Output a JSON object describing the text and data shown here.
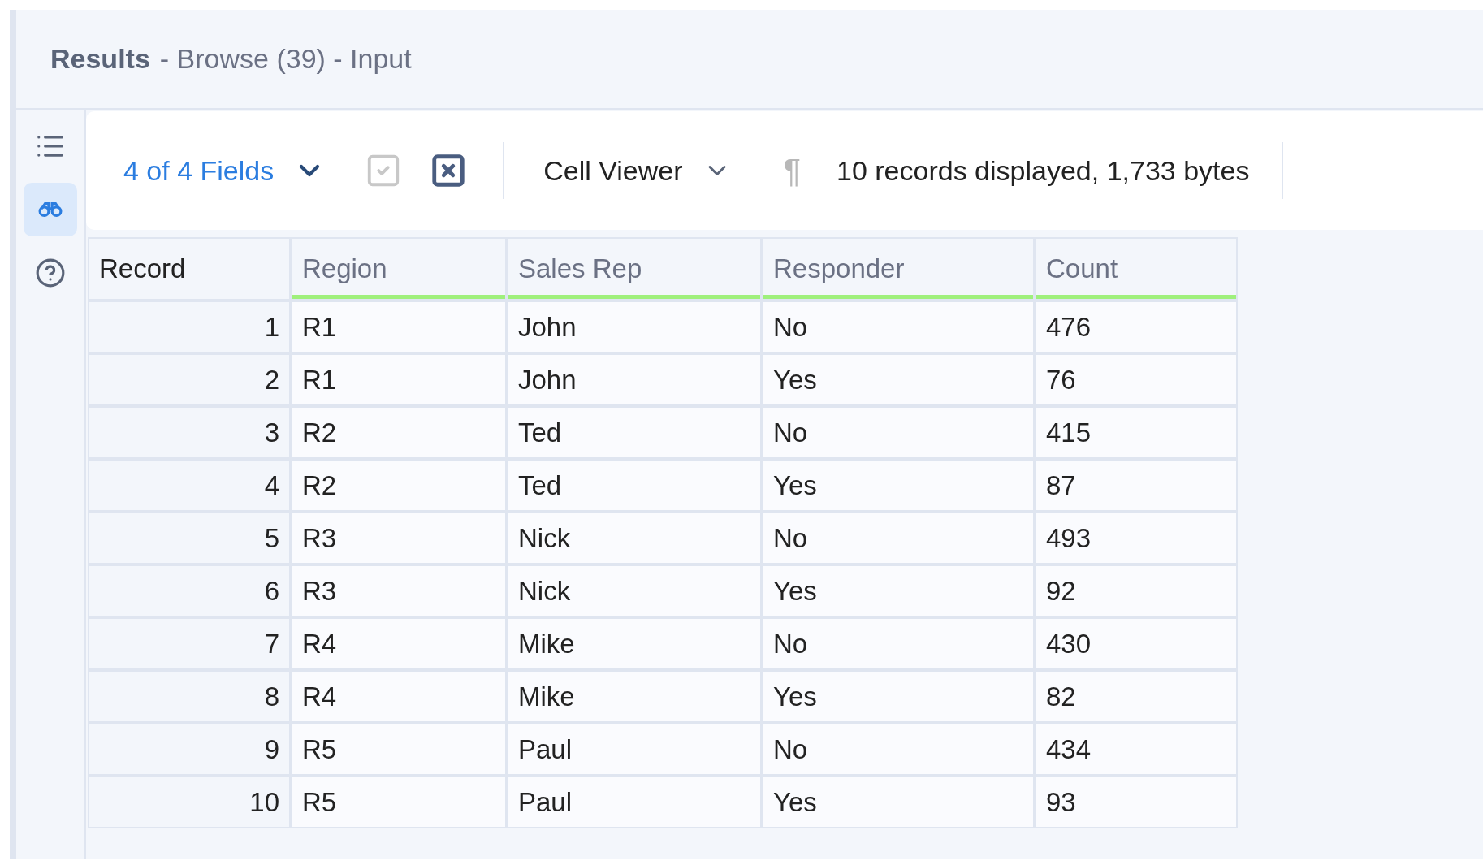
{
  "header": {
    "title": "Results",
    "subtitle": "- Browse (39) - Input"
  },
  "sidebar": {
    "items": [
      {
        "kind": "list",
        "selected": false
      },
      {
        "kind": "binoculars",
        "selected": true
      },
      {
        "kind": "help",
        "selected": false
      }
    ]
  },
  "toolbar": {
    "fields_menu": "4 of 4 Fields",
    "select_all_disabled": true,
    "deselect_all_disabled": false,
    "viewer_menu": "Cell Viewer",
    "pilcrow": "¶",
    "status": "10 records displayed, 1,733 bytes"
  },
  "table": {
    "columns": [
      {
        "label": "Record",
        "kind": "record"
      },
      {
        "label": "Region",
        "kind": "field"
      },
      {
        "label": "Sales Rep",
        "kind": "field"
      },
      {
        "label": "Responder",
        "kind": "field"
      },
      {
        "label": "Count",
        "kind": "field"
      }
    ],
    "rows": [
      [
        "1",
        "R1",
        "John",
        "No",
        "476"
      ],
      [
        "2",
        "R1",
        "John",
        "Yes",
        "76"
      ],
      [
        "3",
        "R2",
        "Ted",
        "No",
        "415"
      ],
      [
        "4",
        "R2",
        "Ted",
        "Yes",
        "87"
      ],
      [
        "5",
        "R3",
        "Nick",
        "No",
        "493"
      ],
      [
        "6",
        "R3",
        "Nick",
        "Yes",
        "92"
      ],
      [
        "7",
        "R4",
        "Mike",
        "No",
        "430"
      ],
      [
        "8",
        "R4",
        "Mike",
        "Yes",
        "82"
      ],
      [
        "9",
        "R5",
        "Paul",
        "No",
        "434"
      ],
      [
        "10",
        "R5",
        "Paul",
        "Yes",
        "93"
      ]
    ]
  }
}
